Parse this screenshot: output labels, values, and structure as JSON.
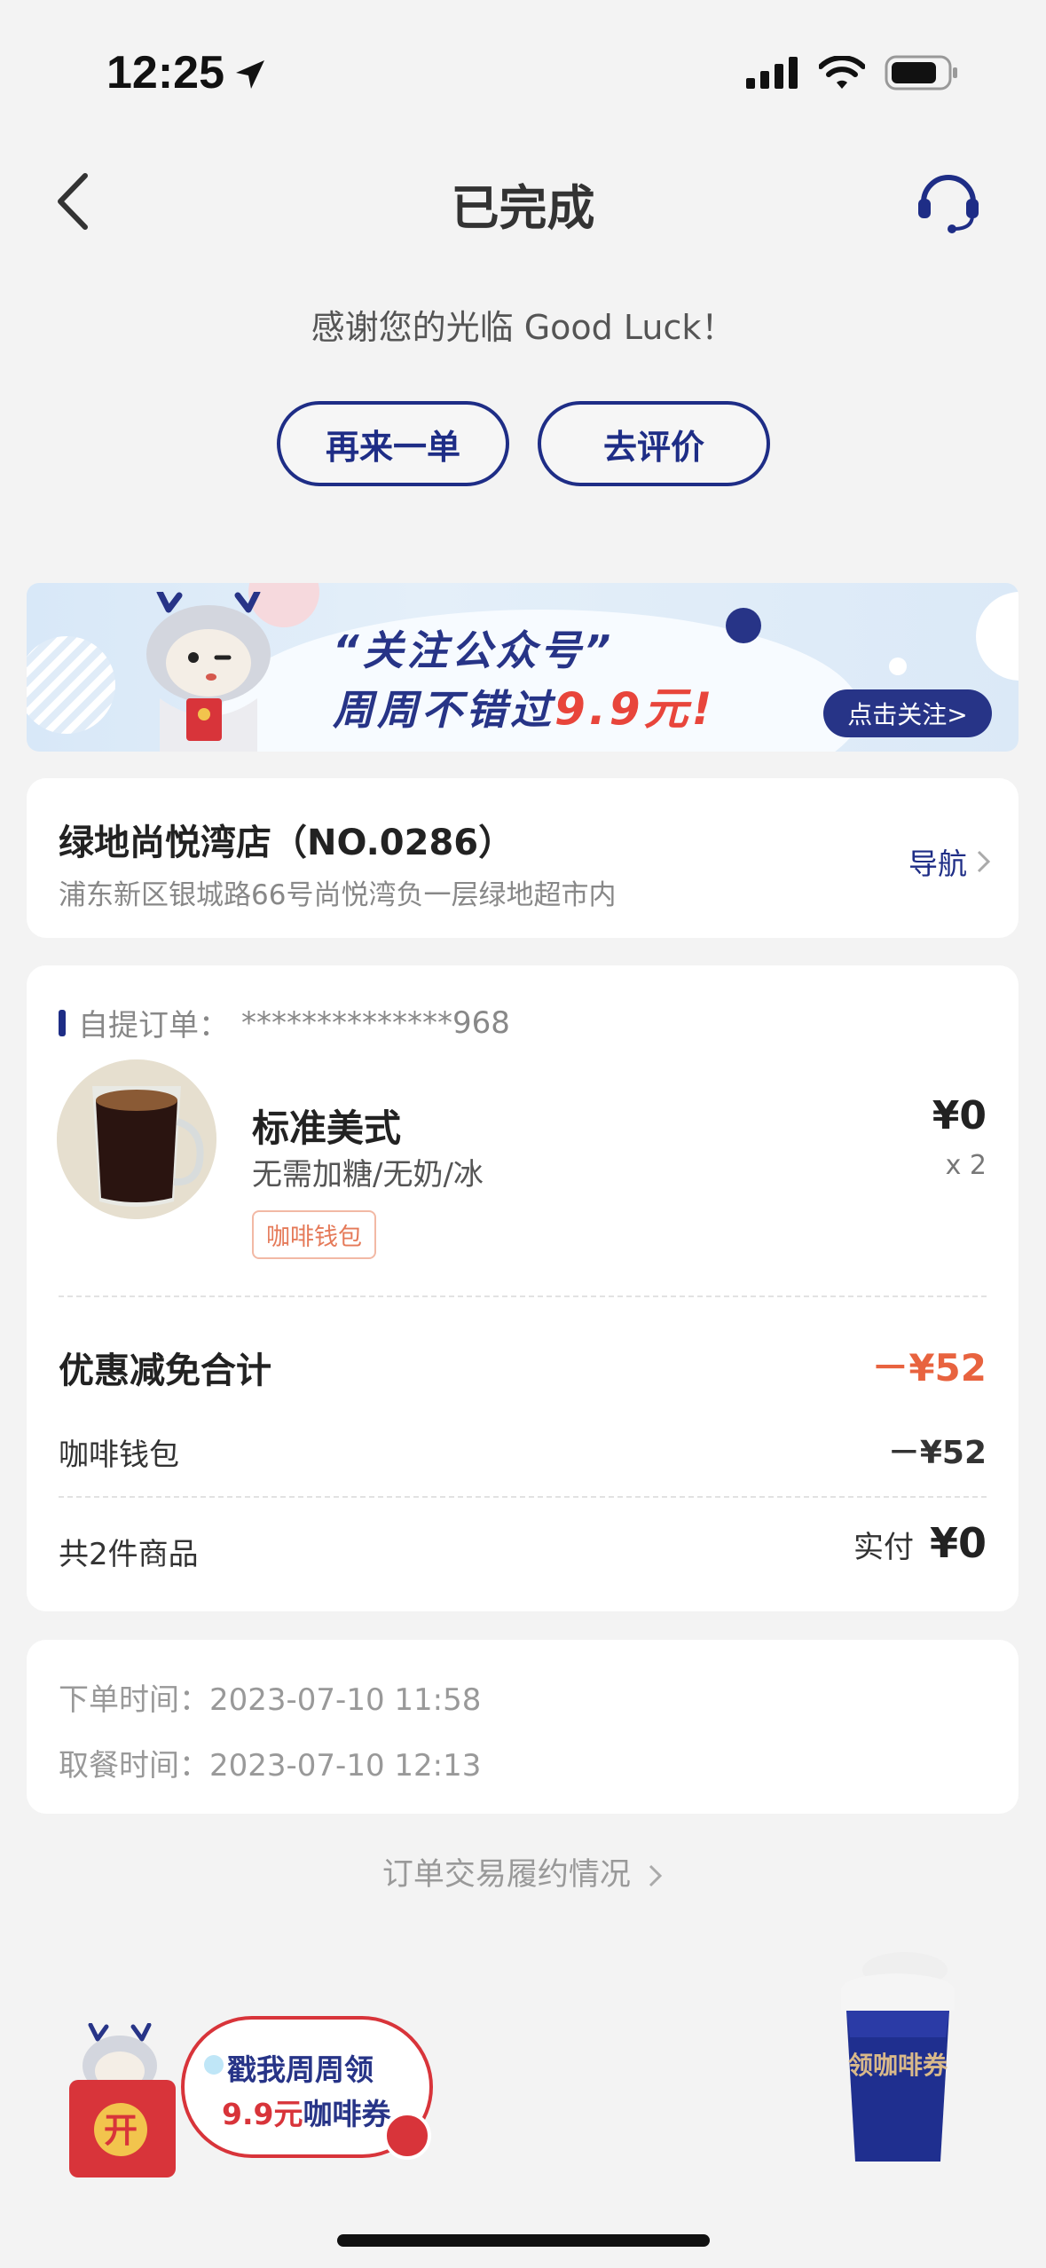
{
  "status_bar": {
    "time": "12:25"
  },
  "header": {
    "title": "已完成"
  },
  "thanks_text": "感谢您的光临 Good Luck！",
  "actions": {
    "reorder": "再来一单",
    "review": "去评价"
  },
  "banner": {
    "line1": "“关注公众号”",
    "line2_prefix": "周周不错过",
    "line2_highlight": "9.9元!",
    "follow_button": "点击关注>"
  },
  "store": {
    "name": "绿地尚悦湾店（NO.0286）",
    "address": "浦东新区银城路66号尚悦湾负一层绿地超市内",
    "nav_label": "导航"
  },
  "order": {
    "label": "自提订单：",
    "number": "**************968",
    "item": {
      "name": "标准美式",
      "spec": "无需加糖/无奶/冰",
      "tag": "咖啡钱包",
      "price": "¥0",
      "qty": "x 2"
    },
    "discount_title": "优惠减免合计",
    "discount_value": "－¥52",
    "wallet_title": "咖啡钱包",
    "wallet_value": "－¥52",
    "total_count": "共2件商品",
    "paid_label": "实付",
    "paid_value": "¥0"
  },
  "times": {
    "order_label": "下单时间：",
    "order_value": "2023-07-10 11:58",
    "pickup_label": "取餐时间：",
    "pickup_value": "2023-07-10 12:13"
  },
  "performance_link": "订单交易履约情况",
  "promo_left": {
    "line1": "戳我周周领",
    "line2_highlight": "9.9元",
    "line2_rest": "咖啡券",
    "envelope_char": "开"
  },
  "promo_right": {
    "cup_text": "领咖啡券"
  },
  "colors": {
    "brand_blue": "#1e2d86",
    "discount_orange": "#e8633f",
    "tag_orange": "#e57a59"
  }
}
